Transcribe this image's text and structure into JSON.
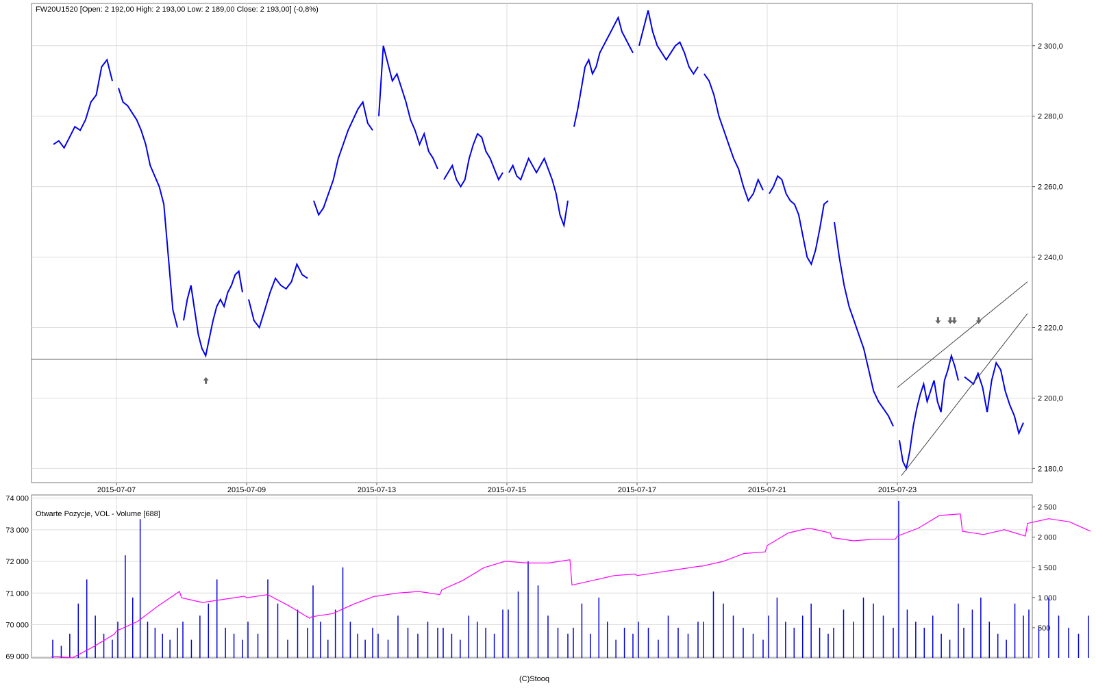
{
  "chart_data": [
    {
      "type": "line",
      "panel": "price",
      "title": "FW20U1520 [Open: 2 192,00  High: 2 193,00  Low: 2 189,00  Close: 2 193,00] (-0,8%)",
      "instrument": "FW20U1520",
      "ohlc": {
        "open": "2 192,00",
        "high": "2 193,00",
        "low": "2 189,00",
        "close": "2 193,00",
        "change": "(-0,8%)"
      },
      "ylim": [
        2176,
        2312
      ],
      "y_ticks": [
        {
          "value": 2180,
          "label": "2 180,0"
        },
        {
          "value": 2200,
          "label": "2 200,0"
        },
        {
          "value": 2220,
          "label": "2 220,0"
        },
        {
          "value": 2240,
          "label": "2 240,0"
        },
        {
          "value": 2260,
          "label": "2 260,0"
        },
        {
          "value": 2280,
          "label": "2 280,0"
        },
        {
          "value": 2300,
          "label": "2 300,0"
        }
      ],
      "x_range": [
        "2015-07-06",
        "2015-07-24"
      ],
      "x_ticks": [
        "2015-07-07",
        "2015-07-09",
        "2015-07-13",
        "2015-07-15",
        "2015-07-17",
        "2015-07-21",
        "2015-07-23"
      ],
      "grid": true,
      "series": [
        {
          "color": "#0000ee",
          "sessions": [
            {
              "date": "2015-07-06",
              "points": [
                2272,
                2273,
                2271,
                2274,
                2277,
                2276,
                2279,
                2284,
                2286,
                2294,
                2296,
                2290
              ]
            },
            {
              "date": "2015-07-07",
              "points": [
                2288,
                2284,
                2283,
                2281,
                2279,
                2276,
                2272,
                2266,
                2263,
                2260,
                2255,
                2240,
                2225,
                2220
              ]
            },
            {
              "date": "2015-07-08",
              "points": [
                2222,
                2228,
                2232,
                2225,
                2218,
                2214,
                2212,
                2217,
                2222,
                2226,
                2228,
                2226,
                2230,
                2232,
                2235,
                2236,
                2230
              ]
            },
            {
              "date": "2015-07-09",
              "points": [
                2228,
                2222,
                2220,
                2225,
                2230,
                2234,
                2232,
                2231,
                2233,
                2238,
                2235,
                2234
              ]
            },
            {
              "date": "2015-07-10",
              "points": [
                2256,
                2252,
                2254,
                2258,
                2262,
                2268,
                2272,
                2276,
                2279,
                2282,
                2284,
                2278,
                2276
              ]
            },
            {
              "date": "2015-07-13",
              "points": [
                2280,
                2300,
                2295,
                2290,
                2292,
                2288,
                2284,
                2279,
                2276,
                2272,
                2275,
                2270,
                2268,
                2265
              ]
            },
            {
              "date": "2015-07-14",
              "points": [
                2262,
                2264,
                2266,
                2262,
                2260,
                2262,
                2268,
                2272,
                2275,
                2274,
                2270,
                2268,
                2265,
                2262,
                2264
              ]
            },
            {
              "date": "2015-07-15",
              "points": [
                2264,
                2266,
                2263,
                2262,
                2265,
                2268,
                2266,
                2264,
                2266,
                2268,
                2265,
                2262,
                2258,
                2252,
                2249,
                2256
              ]
            },
            {
              "date": "2015-07-16",
              "points": [
                2277,
                2282,
                2288,
                2294,
                2296,
                2292,
                2294,
                2298,
                2300,
                2302,
                2304,
                2306,
                2308,
                2304,
                2302,
                2300,
                2298
              ]
            },
            {
              "date": "2015-07-17",
              "points": [
                2300,
                2305,
                2310,
                2304,
                2300,
                2298,
                2296,
                2298,
                2300,
                2301,
                2298,
                2294,
                2292,
                2294
              ]
            },
            {
              "date": "2015-07-20",
              "points": [
                2292,
                2290,
                2286,
                2280,
                2276,
                2272,
                2268,
                2265,
                2260,
                2256,
                2258,
                2262,
                2259
              ]
            },
            {
              "date": "2015-07-21",
              "points": [
                2258,
                2260,
                2263,
                2262,
                2258,
                2256,
                2255,
                2252,
                2246,
                2240,
                2238,
                2242,
                2248,
                2255,
                2256
              ]
            },
            {
              "date": "2015-07-22",
              "points": [
                2250,
                2240,
                2232,
                2226,
                2222,
                2218,
                2214,
                2208,
                2202,
                2199,
                2197,
                2195,
                2192
              ]
            },
            {
              "date": "2015-07-23",
              "points": [
                2188,
                2182,
                2180,
                2185,
                2192,
                2197,
                2201,
                2204,
                2199,
                2202,
                2205,
                2199,
                2196,
                2205,
                2208,
                2212,
                2209,
                2205
              ]
            },
            {
              "date": "2015-07-24",
              "points": [
                2206,
                2205,
                2204,
                2207,
                2203,
                2196,
                2205,
                2210,
                2208,
                2202,
                2198,
                2195,
                2190,
                2193
              ]
            }
          ]
        }
      ],
      "annotations": {
        "horizontal_line": 2211,
        "trend_lines": [
          {
            "from": [
              "2015-07-23 09:00",
              2203
            ],
            "to": [
              "2015-07-24 17:00",
              2233
            ]
          },
          {
            "from": [
              "2015-07-23 09:30",
              2178
            ],
            "to": [
              "2015-07-24 17:00",
              2224
            ]
          }
        ],
        "arrows": [
          {
            "direction": "up",
            "at": [
              "2015-07-08 12:00",
              2205
            ]
          },
          {
            "direction": "down",
            "at": [
              "2015-07-23 14:00",
              2222
            ]
          },
          {
            "direction": "down",
            "at": [
              "2015-07-23 15:30",
              2222
            ]
          },
          {
            "direction": "down",
            "at": [
              "2015-07-23 16:00",
              2222
            ]
          },
          {
            "direction": "down",
            "at": [
              "2015-07-24 11:00",
              2222
            ]
          }
        ]
      }
    },
    {
      "type": "bar",
      "panel": "volume",
      "title": "Otwarte Pozycje, VOL - Volume [688]",
      "bar_color": "#0000dd",
      "line_color": "#ff00ff",
      "left_axis": {
        "ylim": [
          68950,
          74100
        ],
        "ticks": [
          {
            "value": 69000,
            "label": "69 000"
          },
          {
            "value": 70000,
            "label": "70 000"
          },
          {
            "value": 71000,
            "label": "71 000"
          },
          {
            "value": 72000,
            "label": "72 000"
          },
          {
            "value": 73000,
            "label": "73 000"
          },
          {
            "value": 74000,
            "label": "74 000"
          }
        ]
      },
      "right_axis": {
        "ylim": [
          0,
          2700
        ],
        "ticks": [
          {
            "value": 500,
            "label": "500"
          },
          {
            "value": 1000,
            "label": "1 000"
          },
          {
            "value": 1500,
            "label": "1 500"
          },
          {
            "value": 2000,
            "label": "2 000"
          },
          {
            "value": 2500,
            "label": "2 500"
          }
        ]
      },
      "series": [
        {
          "axis": "left",
          "session_points": [
            [
              69000,
              68950,
              69300,
              69700
            ],
            [
              69800,
              70100,
              70600,
              71050
            ],
            [
              70850,
              70700,
              70800,
              70900
            ],
            [
              70850,
              70950,
              70600,
              70200
            ],
            [
              70250,
              70350,
              70650,
              70900
            ],
            [
              70900,
              71000,
              71050,
              70950
            ],
            [
              71100,
              71400,
              71800,
              72000
            ],
            [
              72000,
              71950,
              71950,
              72050
            ],
            [
              71250,
              71400,
              71550,
              71600
            ],
            [
              71550,
              71650,
              71750,
              71850
            ],
            [
              71850,
              72000,
              72250,
              72300
            ],
            [
              72500,
              72900,
              73050,
              72900
            ],
            [
              72750,
              72650,
              72700,
              72700
            ],
            [
              72800,
              73050,
              73450,
              73500
            ],
            [
              72950,
              72850,
              73000,
              72800
            ],
            [
              73200,
              73350,
              73250,
              72950
            ]
          ],
          "last_value": 72900
        },
        {
          "axis": "right",
          "values_by_session": [
            [
              300,
              200,
              400,
              900,
              1300,
              700,
              400,
              300
            ],
            [
              600,
              1700,
              1000,
              2300,
              600,
              500,
              400,
              300,
              500
            ],
            [
              600,
              300,
              700,
              900,
              1300,
              500,
              400,
              300
            ],
            [
              600,
              400,
              1300,
              900,
              300,
              800,
              500
            ],
            [
              1200,
              600,
              300,
              800,
              1500,
              600,
              400,
              300,
              500
            ],
            [
              400,
              300,
              700,
              500,
              400,
              600,
              500
            ],
            [
              500,
              400,
              300,
              700,
              600,
              500,
              400,
              800
            ],
            [
              800,
              1100,
              1600,
              1200,
              700,
              500,
              400
            ],
            [
              500,
              900,
              400,
              1000,
              600,
              300,
              500,
              400
            ],
            [
              600,
              500,
              300,
              700,
              500,
              400,
              600
            ],
            [
              600,
              1100,
              900,
              700,
              500,
              400,
              300
            ],
            [
              700,
              1000,
              600,
              500,
              700,
              900,
              500,
              400
            ],
            [
              500,
              800,
              600,
              1000,
              900,
              700,
              500
            ],
            [
              2600,
              800,
              600,
              500,
              700,
              400,
              300,
              900
            ],
            [
              500,
              800,
              1000,
              600,
              400,
              300,
              900,
              700
            ],
            [
              800,
              500,
              1000,
              700,
              500,
              400,
              700
            ]
          ]
        }
      ]
    }
  ],
  "footer": {
    "copyright": "(C)Stooq"
  }
}
